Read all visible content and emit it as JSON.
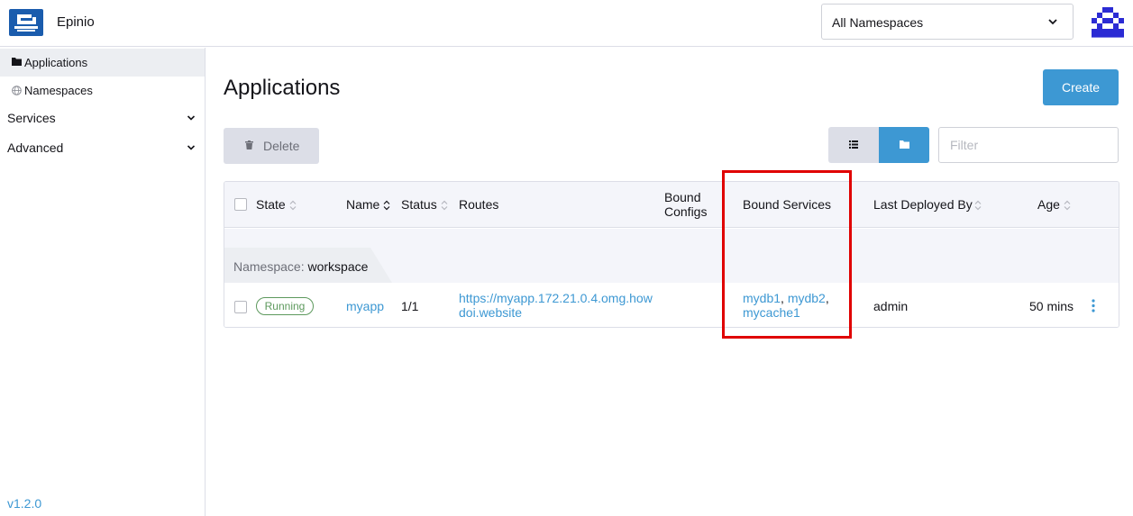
{
  "header": {
    "app_title": "Epinio",
    "namespace_select": "All Namespaces",
    "logo_icon": "epinio-logo-icon",
    "avatar_icon": "user-avatar-icon"
  },
  "sidebar": {
    "items": [
      {
        "label": "Applications",
        "icon": "folder-icon",
        "active": true
      },
      {
        "label": "Namespaces",
        "icon": "globe-icon",
        "active": false
      }
    ],
    "groups": [
      {
        "label": "Services"
      },
      {
        "label": "Advanced"
      }
    ],
    "version": "v1.2.0"
  },
  "main": {
    "title": "Applications",
    "create_label": "Create",
    "delete_label": "Delete",
    "filter_placeholder": "Filter"
  },
  "table": {
    "columns": {
      "state": "State",
      "name": "Name",
      "status": "Status",
      "routes": "Routes",
      "bound_configs_1": "Bound",
      "bound_configs_2": "Configs",
      "bound_services": "Bound Services",
      "last_deployed_by": "Last Deployed By",
      "age": "Age"
    },
    "group": {
      "label": "Namespace:",
      "value": "workspace"
    },
    "rows": [
      {
        "state": "Running",
        "name": "myapp",
        "status": "1/1",
        "route_1": "https://myapp.172.21.0.4.omg.how",
        "route_2": "doi.website",
        "services": [
          "mydb1",
          "mydb2",
          "mycache1"
        ],
        "sep": ",",
        "last_deployed_by": "admin",
        "age": "50 mins"
      }
    ]
  },
  "colors": {
    "accent": "#3d98d3",
    "running": "#5d995d",
    "highlight": "#e00000"
  }
}
